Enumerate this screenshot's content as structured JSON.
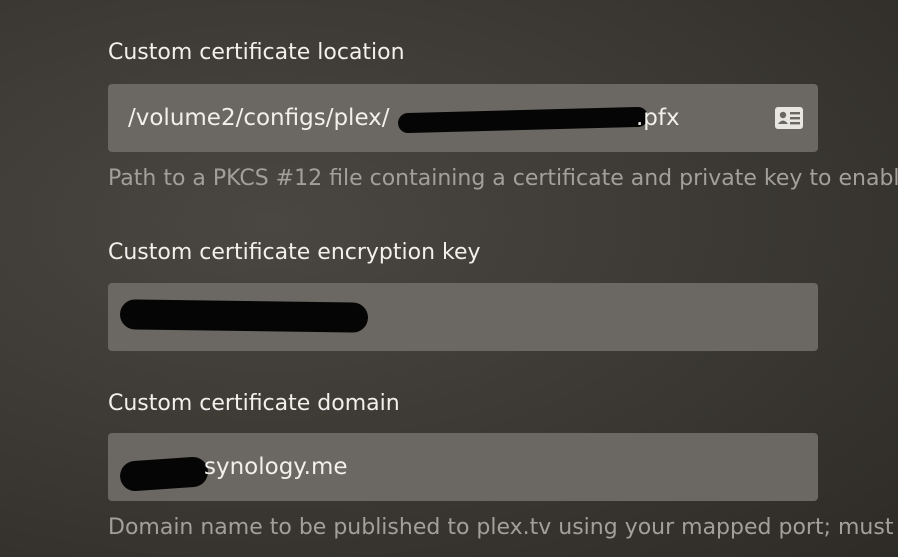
{
  "fields": [
    {
      "label": "Custom certificate location",
      "value": "/volume2/configs/plex/",
      "value_suffix": ".pfx",
      "help": "Path to a PKCS #12 file containing a certificate and private key to enable",
      "icon": "id-card-icon"
    },
    {
      "label": "Custom certificate encryption key",
      "value": ""
    },
    {
      "label": "Custom certificate domain",
      "value": "synology.me",
      "help": "Domain name to be published to plex.tv using your mapped port; must"
    }
  ],
  "colors": {
    "background": "#3b3833",
    "input_background": "#6b6762",
    "label": "#f2f0ec",
    "help": "#a39f99"
  }
}
